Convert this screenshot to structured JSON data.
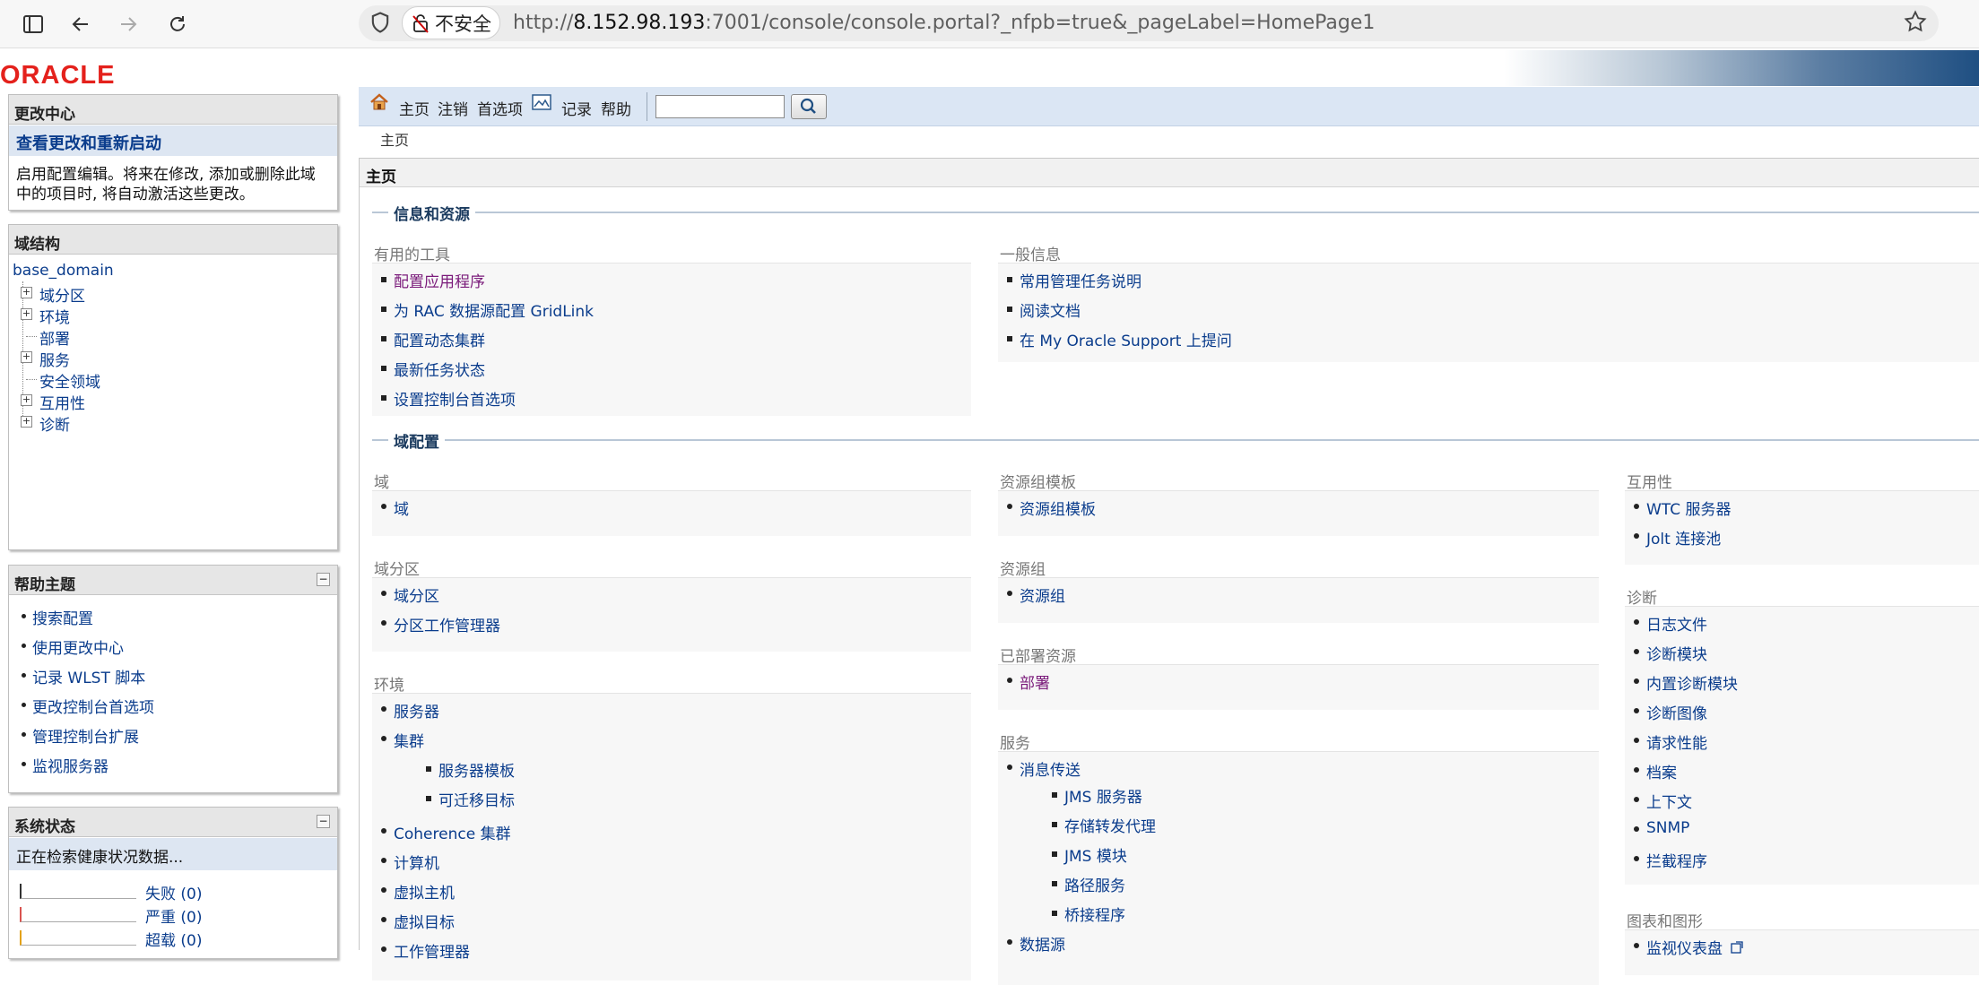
{
  "browser": {
    "insecure_label": "不安全",
    "url_scheme": "http://",
    "url_host": "8.152.98.193",
    "url_rest": ":7001/console/console.portal?_nfpb=true&_pageLabel=HomePage1"
  },
  "logo": "ORACLE",
  "change_center": {
    "title": "更改中心",
    "link": "查看更改和重新启动",
    "text": "启用配置编辑。将来在修改, 添加或删除此域中的项目时, 将自动激活这些更改。"
  },
  "domain_structure": {
    "title": "域结构",
    "root": "base_domain",
    "nodes": [
      "域分区",
      "环境",
      "部署",
      "服务",
      "安全领域",
      "互用性",
      "诊断"
    ]
  },
  "help_topics": {
    "title": "帮助主题",
    "items": [
      "搜索配置",
      "使用更改中心",
      "记录 WLST 脚本",
      "更改控制台首选项",
      "管理控制台扩展",
      "监视服务器"
    ]
  },
  "system_status": {
    "title": "系统状态",
    "text": "正在检索健康状况数据...",
    "rows": [
      {
        "label": "失败 (0)",
        "color": "#333333"
      },
      {
        "label": "严重 (0)",
        "color": "#d9534f"
      },
      {
        "label": "超载 (0)",
        "color": "#e3a21a"
      }
    ]
  },
  "toolbar": {
    "home": "主页",
    "logout": "注销",
    "preferences": "首选项",
    "record": "记录",
    "help": "帮助",
    "search_value": ""
  },
  "breadcrumb": "主页",
  "main": {
    "title": "主页",
    "sec_info": "信息和资源",
    "tools_head": "有用的工具",
    "tools": [
      "配置应用程序",
      "为 RAC 数据源配置 GridLink",
      "配置动态集群",
      "最新任务状态",
      "设置控制台首选项"
    ],
    "general_head": "一般信息",
    "general": [
      "常用管理任务说明",
      "阅读文档",
      "在 My Oracle Support 上提问"
    ],
    "sec_domain": "域配置",
    "domain_head": "域",
    "domain_items": [
      "域"
    ],
    "partitions_head": "域分区",
    "partitions_items": [
      "域分区",
      "分区工作管理器"
    ],
    "env_head": "环境",
    "env_items": [
      "服务器",
      "集群"
    ],
    "cluster_sub": [
      "服务器模板",
      "可迁移目标"
    ],
    "env_items2": [
      "Coherence 集群",
      "计算机",
      "虚拟主机",
      "虚拟目标",
      "工作管理器"
    ],
    "rgt_head": "资源组模板",
    "rgt_items": [
      "资源组模板"
    ],
    "rg_head": "资源组",
    "rg_items": [
      "资源组"
    ],
    "deployed_head": "已部署资源",
    "deployed_items": [
      "部署"
    ],
    "services_head": "服务",
    "services_items": [
      "消息传送"
    ],
    "messaging_sub": [
      "JMS 服务器",
      "存储转发代理",
      "JMS 模块",
      "路径服务",
      "桥接程序"
    ],
    "services_items2": [
      "数据源"
    ],
    "interop_head": "互用性",
    "interop_items": [
      "WTC 服务器",
      "Jolt 连接池"
    ],
    "diag_head": "诊断",
    "diag_items": [
      "日志文件",
      "诊断模块",
      "内置诊断模块",
      "诊断图像",
      "请求性能",
      "档案",
      "上下文",
      "SNMP",
      "拦截程序"
    ],
    "charts_head": "图表和图形",
    "charts_items": [
      "监视仪表盘"
    ]
  }
}
